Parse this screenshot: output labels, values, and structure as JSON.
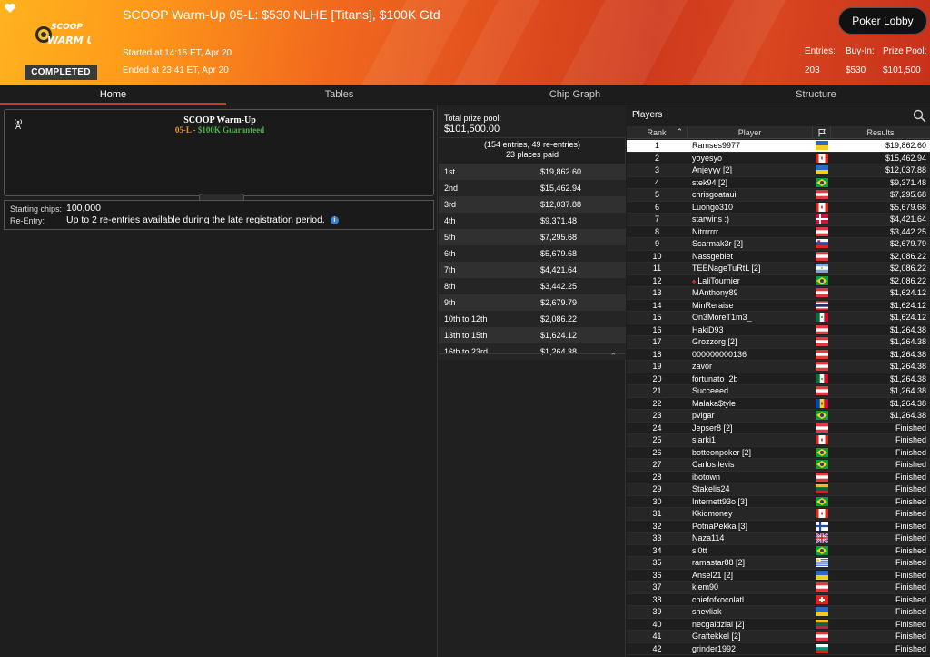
{
  "header": {
    "title": "SCOOP Warm-Up 05-L: $530 NLHE [Titans], $100K Gtd",
    "started": "Started at 14:15 ET, Apr 20",
    "ended": "Ended at 23:41 ET, Apr 20",
    "status": "COMPLETED",
    "lobby_button": "Poker Lobby",
    "stats": {
      "entries_label": "Entries:",
      "entries_value": "203",
      "buyin_label": "Buy-In:",
      "buyin_value": "$530",
      "prize_label": "Prize Pool:",
      "prize_value": "$101,500"
    },
    "logo_text": "SCOOP WARM UP"
  },
  "tabs": [
    "Home",
    "Tables",
    "Chip Graph",
    "Structure"
  ],
  "home": {
    "info_title": "SCOOP Warm-Up",
    "info_sub_part1": "05-L",
    "info_sub_sep": " - ",
    "info_sub_part2": "$100K Guaranteed",
    "starting_chips_label": "Starting chips:",
    "starting_chips_value": "100,000",
    "reentry_label": "Re-Entry:",
    "reentry_value": "Up to 2 re-entries available during the late registration period."
  },
  "prize": {
    "total_label": "Total prize pool:",
    "total_value": "$101,500.00",
    "entries_line": "(154 entries, 49 re-entries)",
    "places_line": "23 places paid",
    "payouts": [
      {
        "place": "1st",
        "amount": "$19,862.60"
      },
      {
        "place": "2nd",
        "amount": "$15,462.94"
      },
      {
        "place": "3rd",
        "amount": "$12,037.88"
      },
      {
        "place": "4th",
        "amount": "$9,371.48"
      },
      {
        "place": "5th",
        "amount": "$7,295.68"
      },
      {
        "place": "6th",
        "amount": "$5,679.68"
      },
      {
        "place": "7th",
        "amount": "$4,421.64"
      },
      {
        "place": "8th",
        "amount": "$3,442.25"
      },
      {
        "place": "9th",
        "amount": "$2,679.79"
      },
      {
        "place": "10th to 12th",
        "amount": "$2,086.22"
      },
      {
        "place": "13th to 15th",
        "amount": "$1,624.12"
      },
      {
        "place": "16th to 23rd",
        "amount": "$1,264.38"
      }
    ]
  },
  "players": {
    "title": "Players",
    "columns": {
      "rank": "Rank",
      "player": "Player",
      "results": "Results"
    },
    "rows": [
      {
        "rank": "1",
        "name": "Ramses9977",
        "flag": "ukraine",
        "result": "$19,862.60"
      },
      {
        "rank": "2",
        "name": "yoyesyo",
        "flag": "canada",
        "result": "$15,462.94"
      },
      {
        "rank": "3",
        "name": "Anjeyyy [2]",
        "flag": "ukraine",
        "result": "$12,037.88"
      },
      {
        "rank": "4",
        "name": "stek94 [2]",
        "flag": "brazil",
        "result": "$9,371.48"
      },
      {
        "rank": "5",
        "name": "chrisgoataui",
        "flag": "austria",
        "result": "$7,295.68"
      },
      {
        "rank": "6",
        "name": "Luongo310",
        "flag": "canada",
        "result": "$5,679.68"
      },
      {
        "rank": "7",
        "name": "starwins :)",
        "flag": "denmark",
        "result": "$4,421.64"
      },
      {
        "rank": "8",
        "name": "Nitrrrrrr",
        "flag": "austria",
        "result": "$3,442.25"
      },
      {
        "rank": "9",
        "name": "Scarmak3r [2]",
        "flag": "slovenia",
        "result": "$2,679.79"
      },
      {
        "rank": "10",
        "name": "Nassgebiet",
        "flag": "austria",
        "result": "$2,086.22"
      },
      {
        "rank": "11",
        "name": "TEENageTuRtL [2]",
        "flag": "argentina",
        "result": "$2,086.22"
      },
      {
        "rank": "12",
        "name": "LaliTournier",
        "flag": "brazil",
        "ps": true,
        "result": "$2,086.22"
      },
      {
        "rank": "13",
        "name": "MAnthony89",
        "flag": "austria",
        "result": "$1,624.12"
      },
      {
        "rank": "14",
        "name": "MinReraise",
        "flag": "thailand",
        "result": "$1,624.12"
      },
      {
        "rank": "15",
        "name": "On3MoreT1m3_",
        "flag": "mexico",
        "result": "$1,624.12"
      },
      {
        "rank": "16",
        "name": "HakiD93",
        "flag": "austria",
        "result": "$1,264.38"
      },
      {
        "rank": "17",
        "name": "Grozzorg [2]",
        "flag": "austria",
        "result": "$1,264.38"
      },
      {
        "rank": "18",
        "name": "000000000136",
        "flag": "austria",
        "result": "$1,264.38"
      },
      {
        "rank": "19",
        "name": "zavor",
        "flag": "austria",
        "result": "$1,264.38"
      },
      {
        "rank": "20",
        "name": "fortunato_2b",
        "flag": "mexico",
        "result": "$1,264.38"
      },
      {
        "rank": "21",
        "name": "Succeeed",
        "flag": "austria",
        "result": "$1,264.38"
      },
      {
        "rank": "22",
        "name": "Malaka$tyle",
        "flag": "moldova",
        "result": "$1,264.38"
      },
      {
        "rank": "23",
        "name": "pvigar",
        "flag": "brazil",
        "result": "$1,264.38"
      },
      {
        "rank": "24",
        "name": "Jepser8 [2]",
        "flag": "austria",
        "result": "Finished"
      },
      {
        "rank": "25",
        "name": "slarki1",
        "flag": "canada",
        "result": "Finished"
      },
      {
        "rank": "26",
        "name": "botteonpoker [2]",
        "flag": "brazil",
        "result": "Finished"
      },
      {
        "rank": "27",
        "name": "Carlos levis",
        "flag": "brazil",
        "result": "Finished"
      },
      {
        "rank": "28",
        "name": "ibotown",
        "flag": "austria",
        "result": "Finished"
      },
      {
        "rank": "29",
        "name": "Stakelis24",
        "flag": "lithuania",
        "result": "Finished"
      },
      {
        "rank": "30",
        "name": "Internett93o [3]",
        "flag": "brazil",
        "result": "Finished"
      },
      {
        "rank": "31",
        "name": "Kkidmoney",
        "flag": "canada",
        "result": "Finished"
      },
      {
        "rank": "32",
        "name": "PotnaPekka [3]",
        "flag": "finland",
        "result": "Finished"
      },
      {
        "rank": "33",
        "name": "Naza114",
        "flag": "uk",
        "result": "Finished"
      },
      {
        "rank": "34",
        "name": "sl0tt",
        "flag": "brazil",
        "result": "Finished"
      },
      {
        "rank": "35",
        "name": "ramastar88 [2]",
        "flag": "uruguay",
        "result": "Finished"
      },
      {
        "rank": "36",
        "name": "Ansel21 [2]",
        "flag": "ukraine",
        "result": "Finished"
      },
      {
        "rank": "37",
        "name": "klem90",
        "flag": "austria",
        "result": "Finished"
      },
      {
        "rank": "38",
        "name": "chiefofxocolatl",
        "flag": "switzerland",
        "result": "Finished"
      },
      {
        "rank": "39",
        "name": "shevliak",
        "flag": "ukraine",
        "result": "Finished"
      },
      {
        "rank": "40",
        "name": "necgaidziai [2]",
        "flag": "lithuania",
        "result": "Finished"
      },
      {
        "rank": "41",
        "name": "Graftekkel [2]",
        "flag": "austria",
        "result": "Finished"
      },
      {
        "rank": "42",
        "name": "grinder1992",
        "flag": "bulgaria",
        "result": "Finished"
      }
    ]
  }
}
